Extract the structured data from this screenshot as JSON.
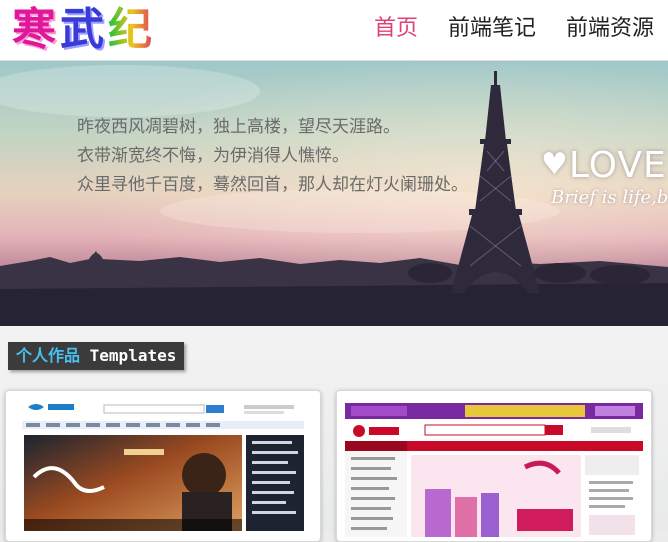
{
  "header": {
    "logo_chars": [
      "寒",
      "武",
      "纪"
    ],
    "nav": [
      {
        "label": "首页",
        "active": true
      },
      {
        "label": "前端笔记",
        "active": false
      },
      {
        "label": "前端资源",
        "active": false
      }
    ]
  },
  "banner": {
    "poem": [
      "昨夜西风凋碧树，独上高楼，望尽天涯路。",
      "衣带渐宽终不悔，为伊消得人憔悴。",
      "众里寻他千百度，蓦然回首，那人却在灯火阑珊处。"
    ],
    "love_heart": "♥",
    "love_text": "LOVE",
    "love_sub": "Brief is life,b"
  },
  "section": {
    "title_cn": "个人作品",
    "title_en": "Templates"
  },
  "colors": {
    "nav_active": "#e0407a",
    "section_title_bg": "#3b3b3b",
    "section_title_cn": "#48c0f0",
    "jd_red": "#c80a28",
    "jd_purple": "#7a2aa0"
  }
}
